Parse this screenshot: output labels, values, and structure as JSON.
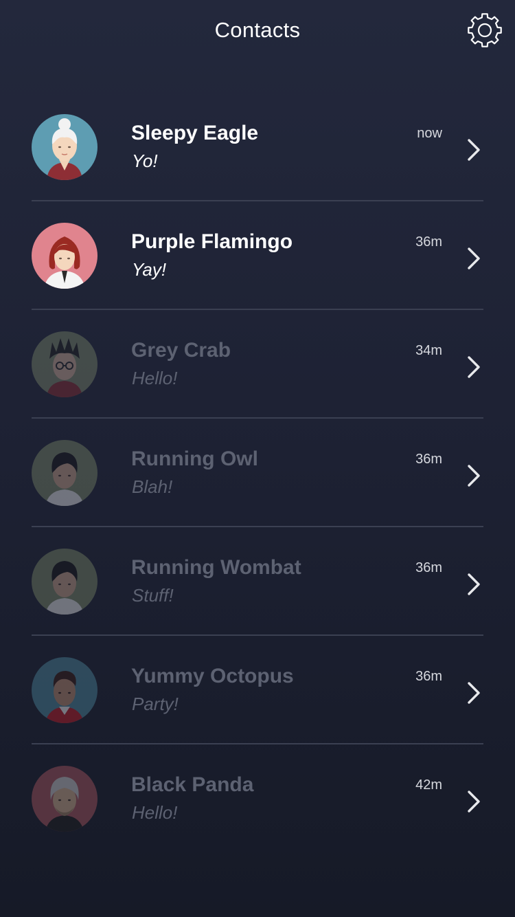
{
  "header": {
    "title": "Contacts",
    "settings_icon": "gear-icon"
  },
  "colors": {
    "background_top": "#23283c",
    "background_bottom": "#161a27",
    "divider": "#3b4052",
    "active_text": "#ffffff",
    "dimmed_text": "#5d6272"
  },
  "contacts": [
    {
      "name": "Sleepy Eagle",
      "message": "Yo!",
      "time": "now",
      "state": "active",
      "avatar_color": "#5e9db2"
    },
    {
      "name": "Purple Flamingo",
      "message": "Yay!",
      "time": "36m",
      "state": "active",
      "avatar_color": "#e0848e"
    },
    {
      "name": "Grey Crab",
      "message": "Hello!",
      "time": "34m",
      "state": "dimmed",
      "avatar_color": "#7d8a6a"
    },
    {
      "name": "Running Owl",
      "message": "Blah!",
      "time": "36m",
      "state": "dimmed",
      "avatar_color": "#7c8a68"
    },
    {
      "name": "Running Wombat",
      "message": "Stuff!",
      "time": "36m",
      "state": "dimmed",
      "avatar_color": "#7c8a68"
    },
    {
      "name": "Yummy Octopus",
      "message": "Party!",
      "time": "36m",
      "state": "dimmed",
      "avatar_color": "#4f8da2"
    },
    {
      "name": "Black Panda",
      "message": "Hello!",
      "time": "42m",
      "state": "dimmed",
      "avatar_color": "#b35a62"
    }
  ]
}
